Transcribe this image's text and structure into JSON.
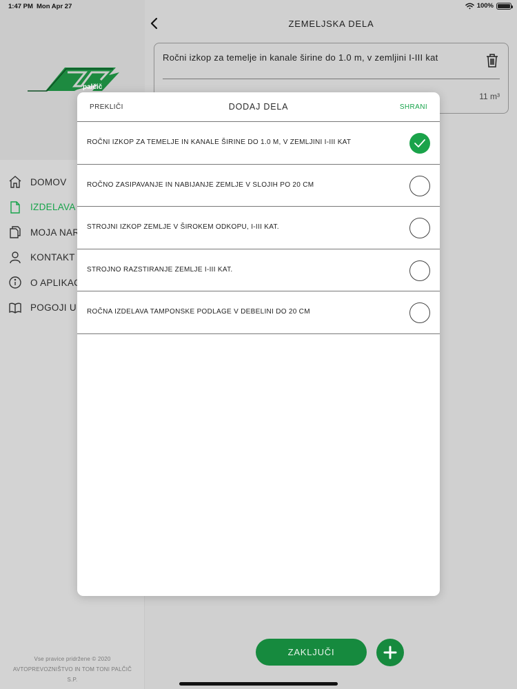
{
  "status_bar": {
    "time": "1:47 PM",
    "date": "Mon Apr 27",
    "battery": "100%"
  },
  "sidebar": {
    "logo_text": "palčič",
    "items": [
      {
        "label": "DOMOV",
        "icon": "home-icon",
        "active": false
      },
      {
        "label": "IZDELAVA",
        "icon": "document-icon",
        "active": true
      },
      {
        "label": "MOJA NAR",
        "icon": "copy-icon",
        "active": false
      },
      {
        "label": "KONTAKT",
        "icon": "person-icon",
        "active": false
      },
      {
        "label": "O APLIKAC",
        "icon": "info-icon",
        "active": false
      },
      {
        "label": "POGOJI UP",
        "icon": "book-icon",
        "active": false
      }
    ],
    "footer": {
      "line1": "Vse pravice pridržene © 2020",
      "line2": "AVTOPREVOZNIŠTVO IN TOM TONI PALČIČ",
      "line3": "S.P."
    }
  },
  "header": {
    "title": "ZEMELJSKA DELA"
  },
  "item_card": {
    "text": "Ročni izkop za temelje in kanale širine do 1.0 m, v zemljini I-III kat",
    "quantity": "11 m³"
  },
  "actions": {
    "finish_label": "ZAKLJUČI"
  },
  "modal": {
    "cancel_label": "PREKLIČI",
    "title": "DODAJ DELA",
    "save_label": "SHRANI",
    "items": [
      {
        "label": "ROČNI IZKOP ZA TEMELJE IN KANALE ŠIRINE DO 1.0 M, V ZEMLJINI I-III KAT",
        "checked": true
      },
      {
        "label": "ROČNO ZASIPAVANJE IN NABIJANJE ZEMLJE V SLOJIH PO 20 CM",
        "checked": false
      },
      {
        "label": "STROJNI IZKOP ZEMLJE V ŠIROKEM ODKOPU, I-III KAT.",
        "checked": false
      },
      {
        "label": "STROJNO RAZSTIRANJE ZEMLJE I-III KAT.",
        "checked": false
      },
      {
        "label": "ROČNA IZDELAVA TAMPONSKE PODLAGE V DEBELINI DO 20 CM",
        "checked": false
      }
    ]
  },
  "colors": {
    "accent": "#16a34a",
    "button": "#168a3e",
    "backdrop": "#d0d0d0",
    "modal_bg": "#ffffff"
  }
}
